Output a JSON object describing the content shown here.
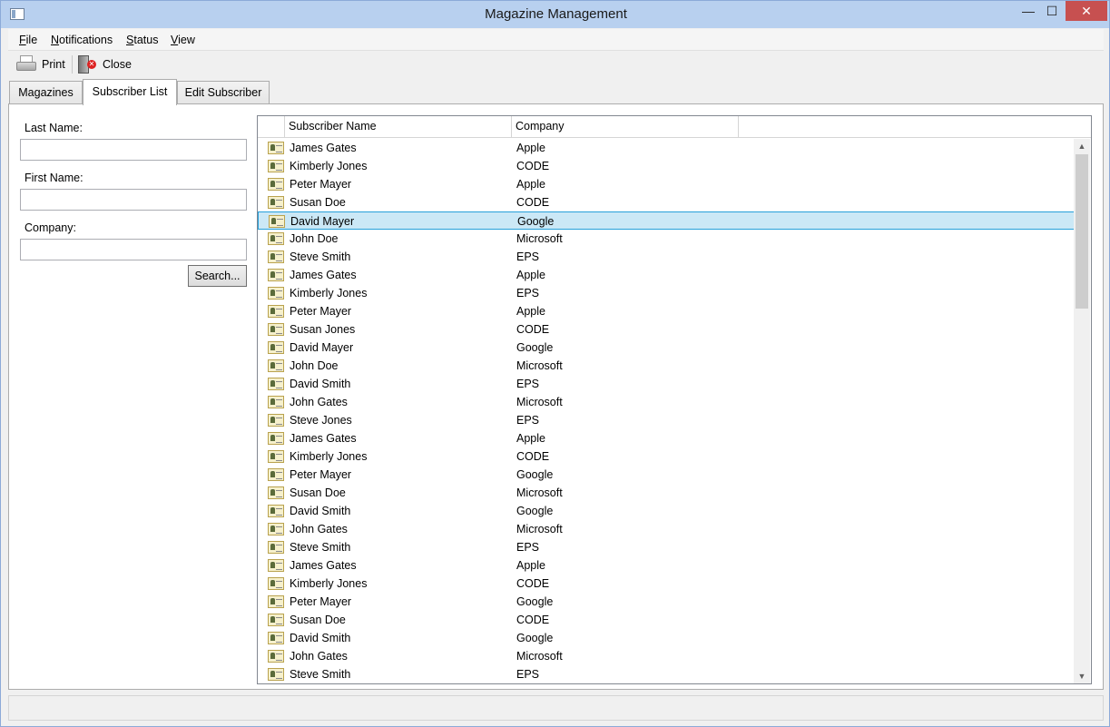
{
  "window": {
    "title": "Magazine Management"
  },
  "titlebar_buttons": {
    "minimize": "—",
    "maximize": "☐",
    "close": "✕"
  },
  "menu": [
    {
      "label": "File",
      "accel": "F",
      "rest": "ile"
    },
    {
      "label": "Notifications",
      "accel": "N",
      "rest": "otifications"
    },
    {
      "label": "Status",
      "accel": "S",
      "rest": "tatus"
    },
    {
      "label": "View",
      "accel": "V",
      "rest": "iew"
    }
  ],
  "toolbar": {
    "print_label": "Print",
    "close_label": "Close"
  },
  "tabs": [
    {
      "label": "Magazines",
      "active": false
    },
    {
      "label": "Subscriber List",
      "active": true
    },
    {
      "label": "Edit Subscriber",
      "active": false
    }
  ],
  "search": {
    "last_name_label": "Last Name:",
    "last_name_value": "",
    "first_name_label": "First Name:",
    "first_name_value": "",
    "company_label": "Company:",
    "company_value": "",
    "search_button": "Search..."
  },
  "list": {
    "columns": [
      "Subscriber Name",
      "Company"
    ],
    "selected_index": 4,
    "rows": [
      {
        "name": "James Gates",
        "company": "Apple"
      },
      {
        "name": "Kimberly Jones",
        "company": "CODE"
      },
      {
        "name": "Peter Mayer",
        "company": "Apple"
      },
      {
        "name": "Susan Doe",
        "company": "CODE"
      },
      {
        "name": "David Mayer",
        "company": "Google"
      },
      {
        "name": "John Doe",
        "company": "Microsoft"
      },
      {
        "name": "Steve Smith",
        "company": "EPS"
      },
      {
        "name": "James Gates",
        "company": "Apple"
      },
      {
        "name": "Kimberly Jones",
        "company": "EPS"
      },
      {
        "name": "Peter Mayer",
        "company": "Apple"
      },
      {
        "name": "Susan Jones",
        "company": "CODE"
      },
      {
        "name": "David Mayer",
        "company": "Google"
      },
      {
        "name": "John Doe",
        "company": "Microsoft"
      },
      {
        "name": "David Smith",
        "company": "EPS"
      },
      {
        "name": "John Gates",
        "company": "Microsoft"
      },
      {
        "name": "Steve Jones",
        "company": "EPS"
      },
      {
        "name": "James Gates",
        "company": "Apple"
      },
      {
        "name": "Kimberly Jones",
        "company": "CODE"
      },
      {
        "name": "Peter Mayer",
        "company": "Google"
      },
      {
        "name": "Susan Doe",
        "company": "Microsoft"
      },
      {
        "name": "David Smith",
        "company": "Google"
      },
      {
        "name": "John Gates",
        "company": "Microsoft"
      },
      {
        "name": "Steve Smith",
        "company": "EPS"
      },
      {
        "name": "James Gates",
        "company": "Apple"
      },
      {
        "name": "Kimberly Jones",
        "company": "CODE"
      },
      {
        "name": "Peter Mayer",
        "company": "Google"
      },
      {
        "name": "Susan Doe",
        "company": "CODE"
      },
      {
        "name": "David Smith",
        "company": "Google"
      },
      {
        "name": "John Gates",
        "company": "Microsoft"
      },
      {
        "name": "Steve Smith",
        "company": "EPS"
      }
    ]
  },
  "icons": {
    "app": "window-icon",
    "print": "printer-icon",
    "close": "exit-door-icon",
    "row": "contact-card-icon"
  },
  "colors": {
    "selection": "#cbe8f6",
    "selection_border": "#26a0da",
    "close_button": "#c75050"
  }
}
